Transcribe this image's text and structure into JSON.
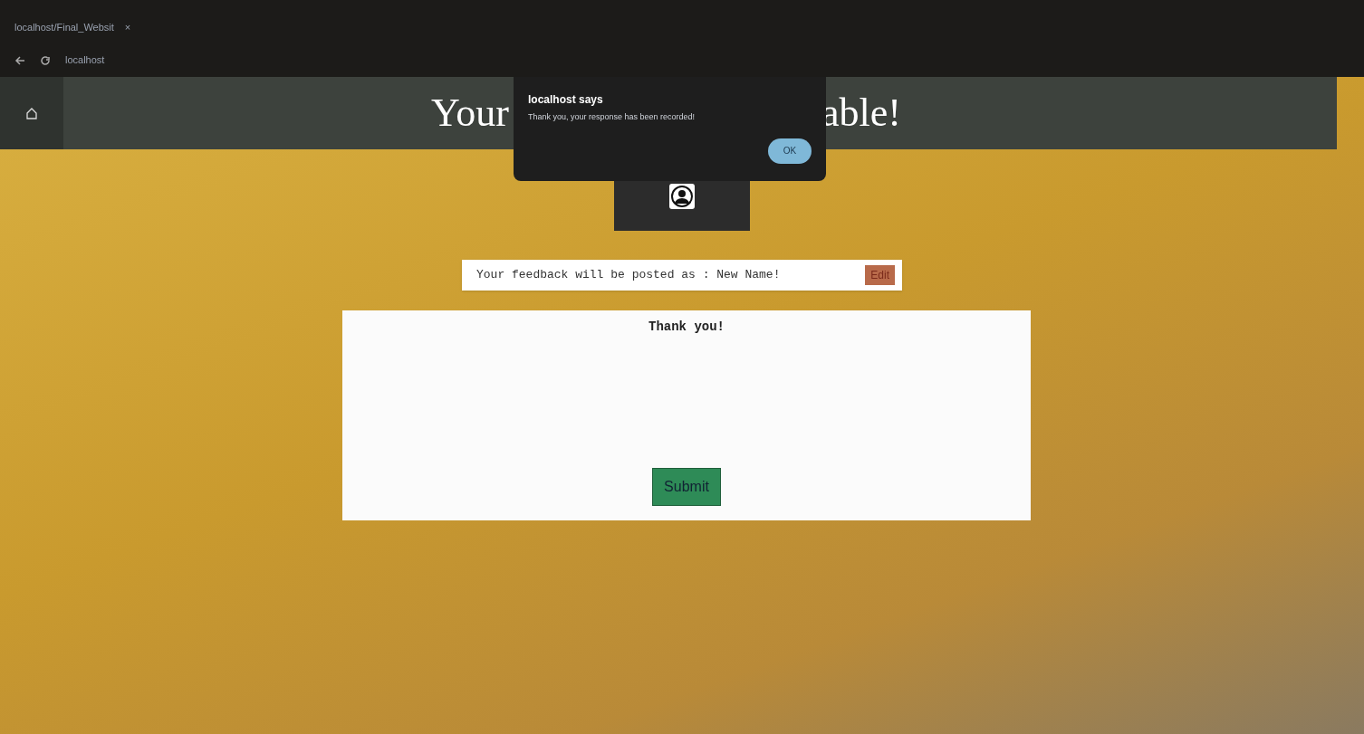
{
  "browser": {
    "tab_title": "localhost/Final_Websit",
    "url": "localhost",
    "tab_close": "×"
  },
  "header": {
    "title_parts": [
      "Your",
      "able!"
    ]
  },
  "dialog": {
    "title": "localhost says",
    "message": "Thank you, your response has been recorded!",
    "button": "OK"
  },
  "feedback_bar": {
    "text": "Your feedback will be posted as : New Name!",
    "button": "Edit"
  },
  "card": {
    "message": "Thank you!",
    "button": "Submit"
  }
}
